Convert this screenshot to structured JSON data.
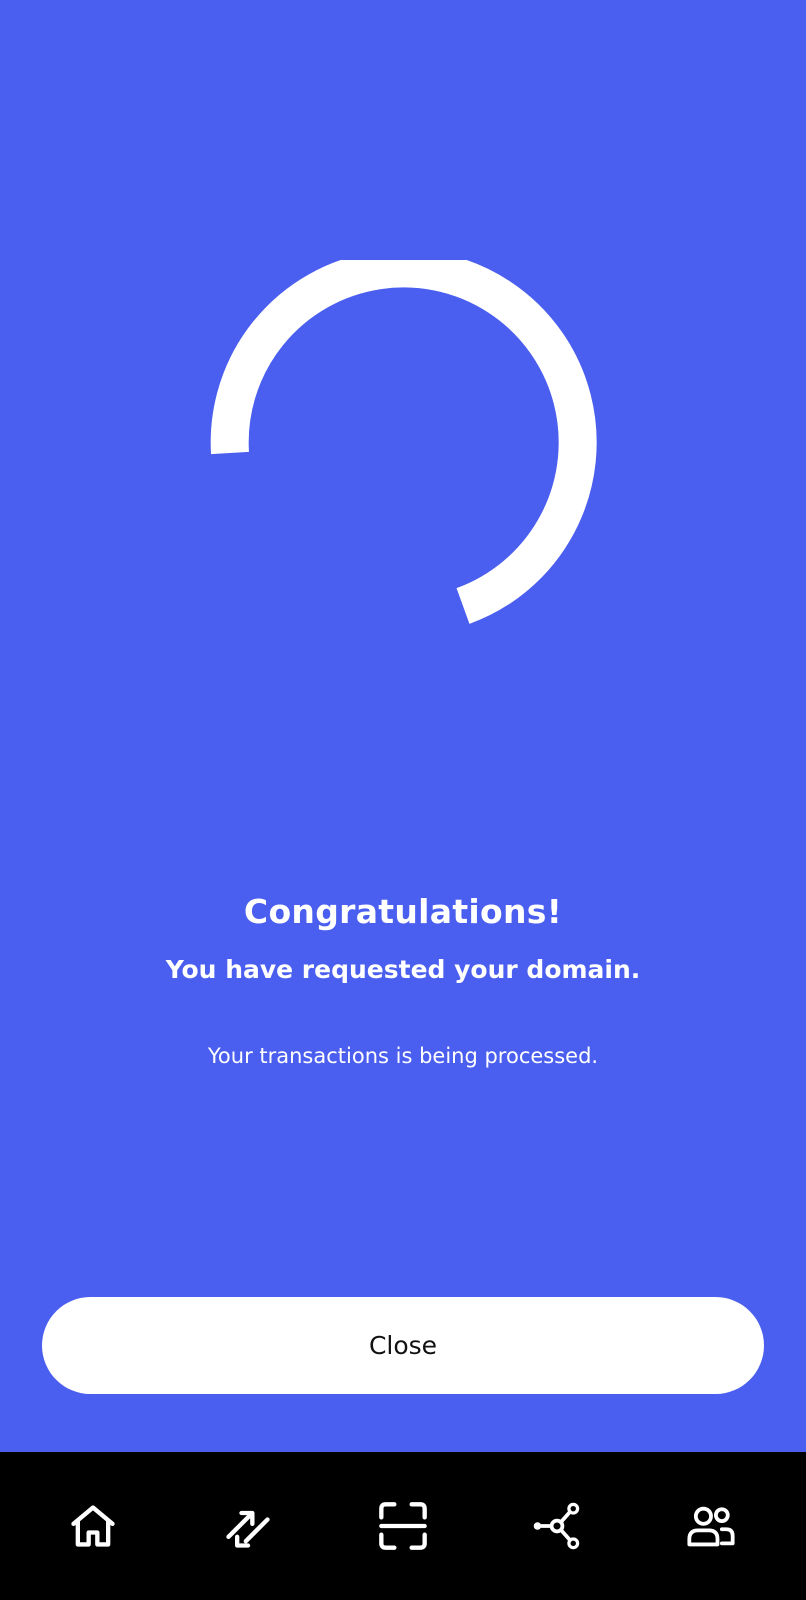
{
  "colors": {
    "background": "#4a5eef",
    "accent": "#ffffff",
    "navbar": "#000000"
  },
  "status": {
    "title": "Congratulations!",
    "subtitle": "You have requested your domain.",
    "note": "Your transactions is being processed."
  },
  "actions": {
    "close_label": "Close"
  },
  "navbar": {
    "items": [
      {
        "icon": "home-icon"
      },
      {
        "icon": "transfer-icon"
      },
      {
        "icon": "scan-icon"
      },
      {
        "icon": "network-icon"
      },
      {
        "icon": "contacts-icon"
      }
    ]
  }
}
